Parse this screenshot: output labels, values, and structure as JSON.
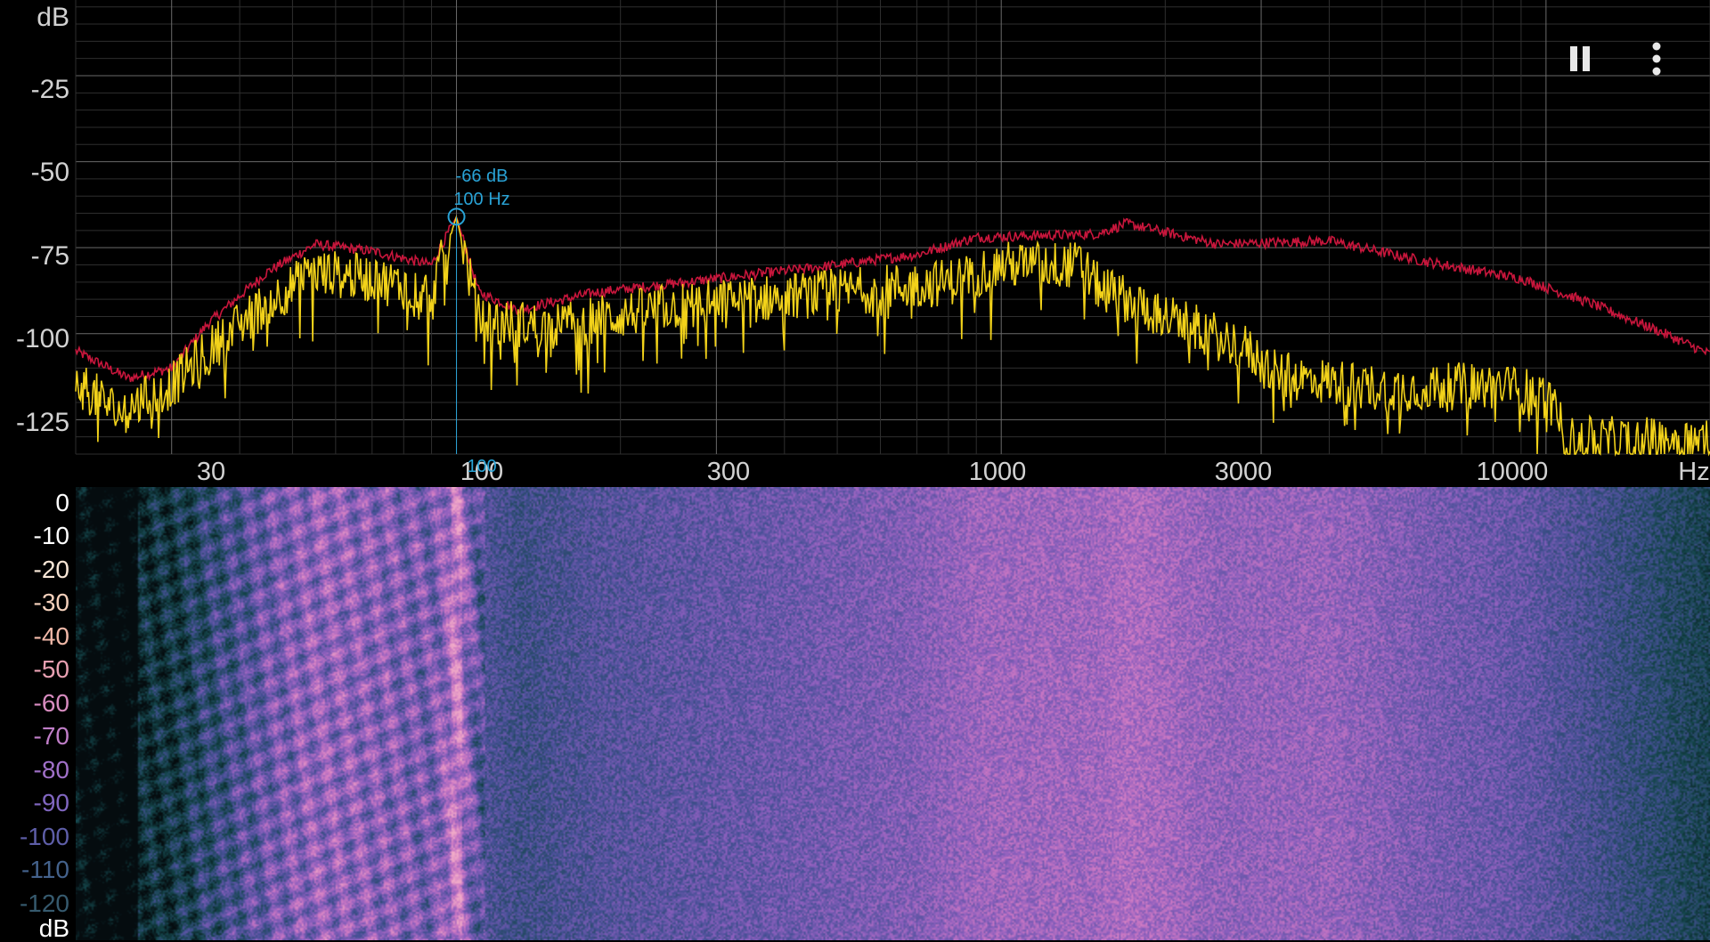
{
  "toolbar": {
    "pause_icon": "pause-icon",
    "menu_icon": "more-vert-icon"
  },
  "spectrum": {
    "y_unit": "dB",
    "x_unit": "Hz",
    "y_ticks": [
      "-25",
      "-50",
      "-75",
      "-100",
      "-125"
    ],
    "x_ticks": [
      "30",
      "100",
      "300",
      "1000",
      "3000",
      "10000"
    ],
    "marker": {
      "db_text": "-66 dB",
      "hz_text": "100 Hz",
      "axis_text": "100"
    }
  },
  "spectrogram": {
    "db_unit": "dB",
    "db_ticks": [
      "0",
      "-10",
      "-20",
      "-30",
      "-40",
      "-50",
      "-60",
      "-70",
      "-80",
      "-90",
      "-100",
      "-110",
      "-120"
    ]
  },
  "colors": {
    "peak_hold": "#c8163c",
    "live": "#f2d21a",
    "marker": "#29a3d6",
    "grid_major": "#6a6a6a",
    "grid_minor": "#2e2e2e"
  }
}
